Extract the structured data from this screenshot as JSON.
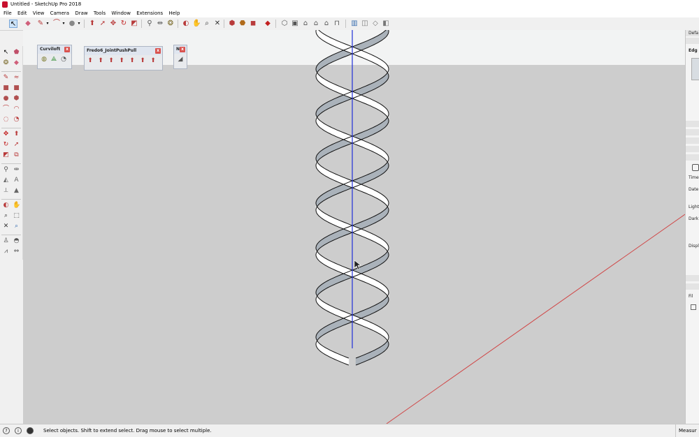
{
  "window": {
    "title": "Untitled - SketchUp Pro 2018"
  },
  "menu": [
    "File",
    "Edit",
    "View",
    "Camera",
    "Draw",
    "Tools",
    "Window",
    "Extensions",
    "Help"
  ],
  "panels": {
    "curviloft": {
      "title": "Curviloft"
    },
    "fredo": {
      "title": "Fredo6_JointPushPull"
    },
    "small": {
      "title": "N"
    }
  },
  "right_panel": {
    "header": "Defa",
    "edge_label": "Edg",
    "time_label": "Time",
    "date_label": "Date",
    "light_label": "Light",
    "dark_label": "Dark",
    "display_label": "Displ",
    "fil_label": "Fil"
  },
  "status": {
    "message": "Select objects. Shift to extend select. Drag mouse to select multiple.",
    "measurements_label": "Measur"
  },
  "colors": {
    "viewport_bg": "#cdcdcd",
    "sky": "#f2f3f3",
    "blue_axis": "#2030d8",
    "red_axis": "#d04545",
    "ribbon_face": "#ffffff",
    "ribbon_back": "#aab2ba"
  },
  "icons": {
    "select": "select-arrow-icon",
    "eraser": "eraser-icon",
    "pencil": "pencil-icon",
    "shape": "shape-icon",
    "pushpull": "pushpull-icon",
    "move": "move-icon",
    "rotate": "rotate-icon",
    "scale": "scale-icon",
    "tape": "tape-measure-icon",
    "paint": "paint-bucket-icon",
    "orbit": "orbit-icon",
    "pan": "pan-icon",
    "zoom": "zoom-icon",
    "zoom_extents": "zoom-extents-icon",
    "warehouse": "warehouse-icon",
    "views": "standard-views-icon"
  }
}
